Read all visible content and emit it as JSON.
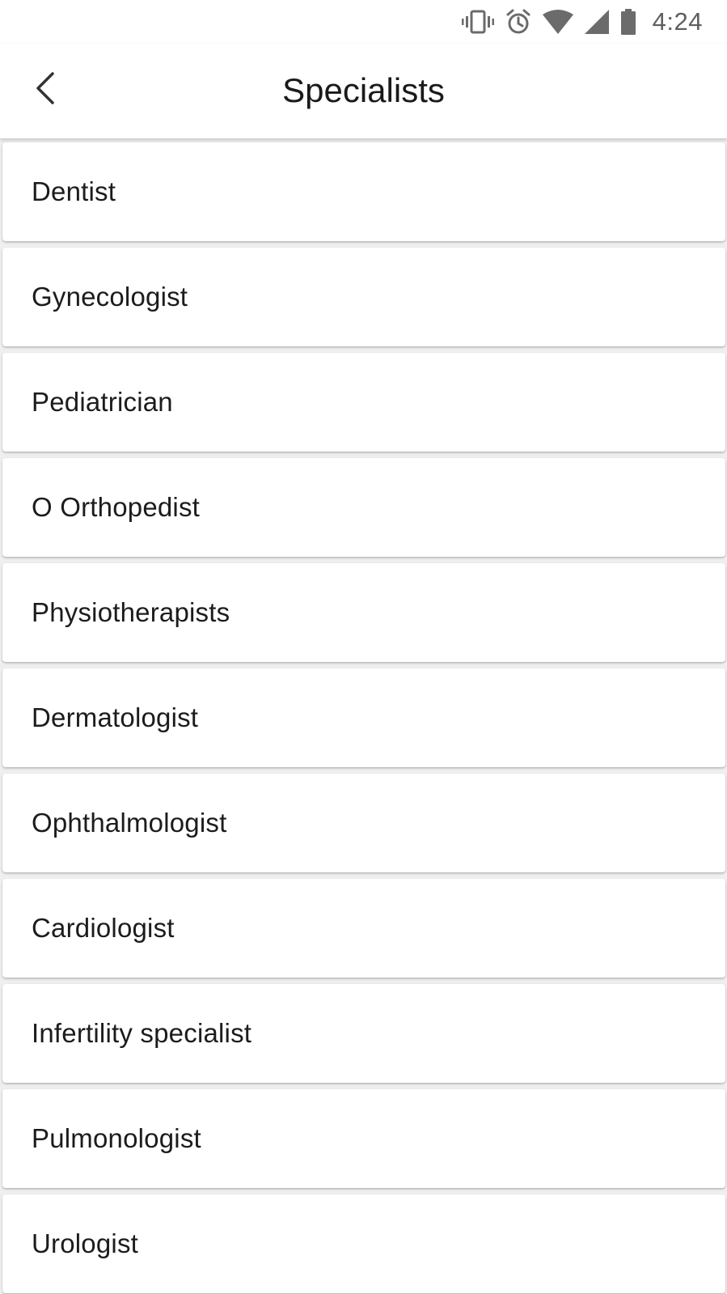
{
  "status_bar": {
    "time": "4:24",
    "icons": [
      "vibrate-icon",
      "alarm-icon",
      "wifi-icon",
      "cellular-signal-icon",
      "battery-icon"
    ],
    "icon_color": "#6b6b6b"
  },
  "app_bar": {
    "back_icon": "chevron-left-icon",
    "title": "Specialists"
  },
  "specialists": [
    {
      "label": "Dentist"
    },
    {
      "label": "Gynecologist"
    },
    {
      "label": "Pediatrician"
    },
    {
      "label": "O Orthopedist"
    },
    {
      "label": "Physiotherapists"
    },
    {
      "label": "Dermatologist"
    },
    {
      "label": "Ophthalmologist"
    },
    {
      "label": "Cardiologist"
    },
    {
      "label": "Infertility specialist"
    },
    {
      "label": "Pulmonologist"
    },
    {
      "label": "Urologist"
    }
  ],
  "colors": {
    "background": "#efefef",
    "card": "#ffffff",
    "text": "#1c1c1c"
  }
}
